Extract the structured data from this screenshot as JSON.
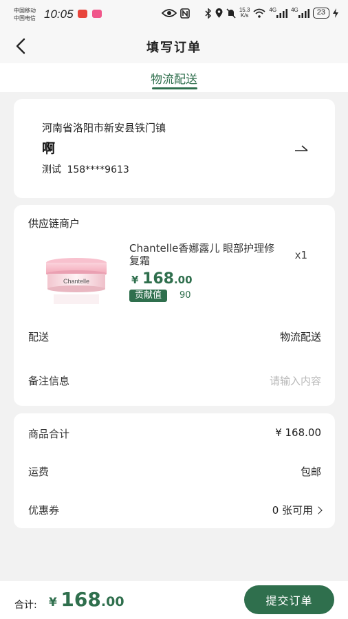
{
  "status_bar": {
    "carrier_1": "中国移动",
    "carrier_2": "中国电信",
    "time": "10:05",
    "net_speed_value": "15.3",
    "net_speed_unit": "K/s",
    "battery": "23",
    "signal_1": "4G",
    "signal_2": "4G",
    "icons": [
      "eye-icon",
      "nfc-icon",
      "bluetooth-icon",
      "location-icon",
      "mute-icon",
      "wifi-icon",
      "signal-icon",
      "battery-icon",
      "charging-icon"
    ]
  },
  "header": {
    "title": "填写订单",
    "back_icon": "chevron-left-icon"
  },
  "tabs": [
    {
      "label": "物流配送",
      "active": true
    }
  ],
  "address": {
    "region": "河南省洛阳市新安县铁门镇",
    "detail": "啊",
    "name": "测试",
    "phone": "158****9613",
    "arrow_icon": "arrow-right-icon"
  },
  "order": {
    "merchant": "供应链商户",
    "product": {
      "name": "Chantelle香娜露儿 眼部护理修复霜",
      "quantity": "x1",
      "price_currency": "¥",
      "price_int": "168",
      "price_dec": ".00",
      "contribution_label": "贡献值",
      "contribution_value": "90",
      "image_brand": "Chantelle"
    },
    "delivery_label": "配送",
    "delivery_value": "物流配送",
    "remark_label": "备注信息",
    "remark_placeholder": "请输入内容"
  },
  "summary": {
    "goods_total_label": "商品合计",
    "goods_total_value": "¥ 168.00",
    "shipping_label": "运费",
    "shipping_value": "包邮",
    "coupon_label": "优惠券",
    "coupon_value": "0 张可用"
  },
  "bottom": {
    "total_label": "合计:",
    "total_currency": "¥",
    "total_int": "168",
    "total_dec": ".00",
    "submit_label": "提交订单"
  },
  "colors": {
    "accent": "#2f6f4d",
    "background": "#f2f2f2",
    "card": "#ffffff",
    "placeholder": "#b8b8b8"
  }
}
